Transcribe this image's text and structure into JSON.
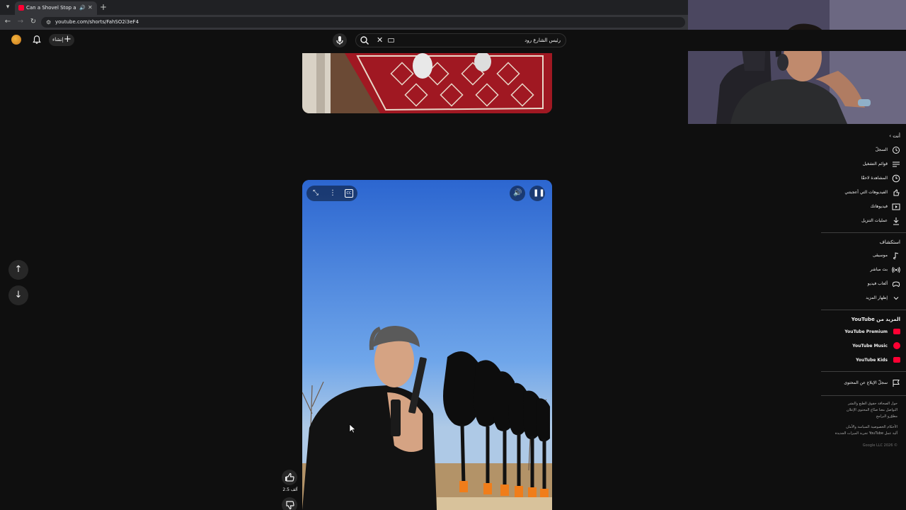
{
  "browser": {
    "tab_title": "Can a Shovel Stop a Bullet?",
    "url": "youtube.com/shorts/FahSO2i3eF4",
    "new_tab_symbol": "+",
    "close_symbol": "✕"
  },
  "header": {
    "create_label": "إنشاء",
    "create_symbol": "+",
    "search_value": "رئيس الشارع رود"
  },
  "short": {
    "like_count": "2.5 ألف"
  },
  "sidebar": {
    "you_heading": "أنت",
    "you_items": [
      {
        "label": "السجلّ",
        "icon": "history-icon"
      },
      {
        "label": "قوائم التشغيل",
        "icon": "playlists-icon"
      },
      {
        "label": "المشاهدة لاحقًا",
        "icon": "watch-later-icon"
      },
      {
        "label": "الفيديوهات التي أعجبتني",
        "icon": "liked-videos-icon"
      },
      {
        "label": "فيديوهاتك",
        "icon": "your-videos-icon"
      },
      {
        "label": "عمليات التنزيل",
        "icon": "downloads-icon"
      }
    ],
    "explore_heading": "استكشاف",
    "explore_items": [
      {
        "label": "موسيقى",
        "icon": "music-icon"
      },
      {
        "label": "بث مباشر",
        "icon": "live-icon"
      },
      {
        "label": "ألعاب فيديو",
        "icon": "gaming-icon"
      },
      {
        "label": "إظهار المزيد",
        "icon": "chevron-down-icon"
      }
    ],
    "more_heading": "المزيد من YouTube",
    "more_items": [
      {
        "label": "YouTube Premium",
        "icon": "youtube-premium-icon"
      },
      {
        "label": "YouTube Music",
        "icon": "youtube-music-icon"
      },
      {
        "label": "YouTube Kids",
        "icon": "youtube-kids-icon"
      }
    ],
    "report_label": "سجلّ الإبلاغ عن المحتوى",
    "footer_lines": [
      "حول  الصحافة  حقوق الطبع والنشر",
      "التواصل معنا  صنّاع المحتوى  الإعلان",
      "مطوّرو البرامج",
      "الأحكام  الخصوصية  السياسة والأمان",
      "آلية عمل YouTube  تجربة الميزات الجديدة",
      "© 2026 Google LLC"
    ]
  },
  "colors": {
    "background": "#0f0f0f",
    "youtube_red": "#ff0033",
    "chip": "#272727"
  }
}
